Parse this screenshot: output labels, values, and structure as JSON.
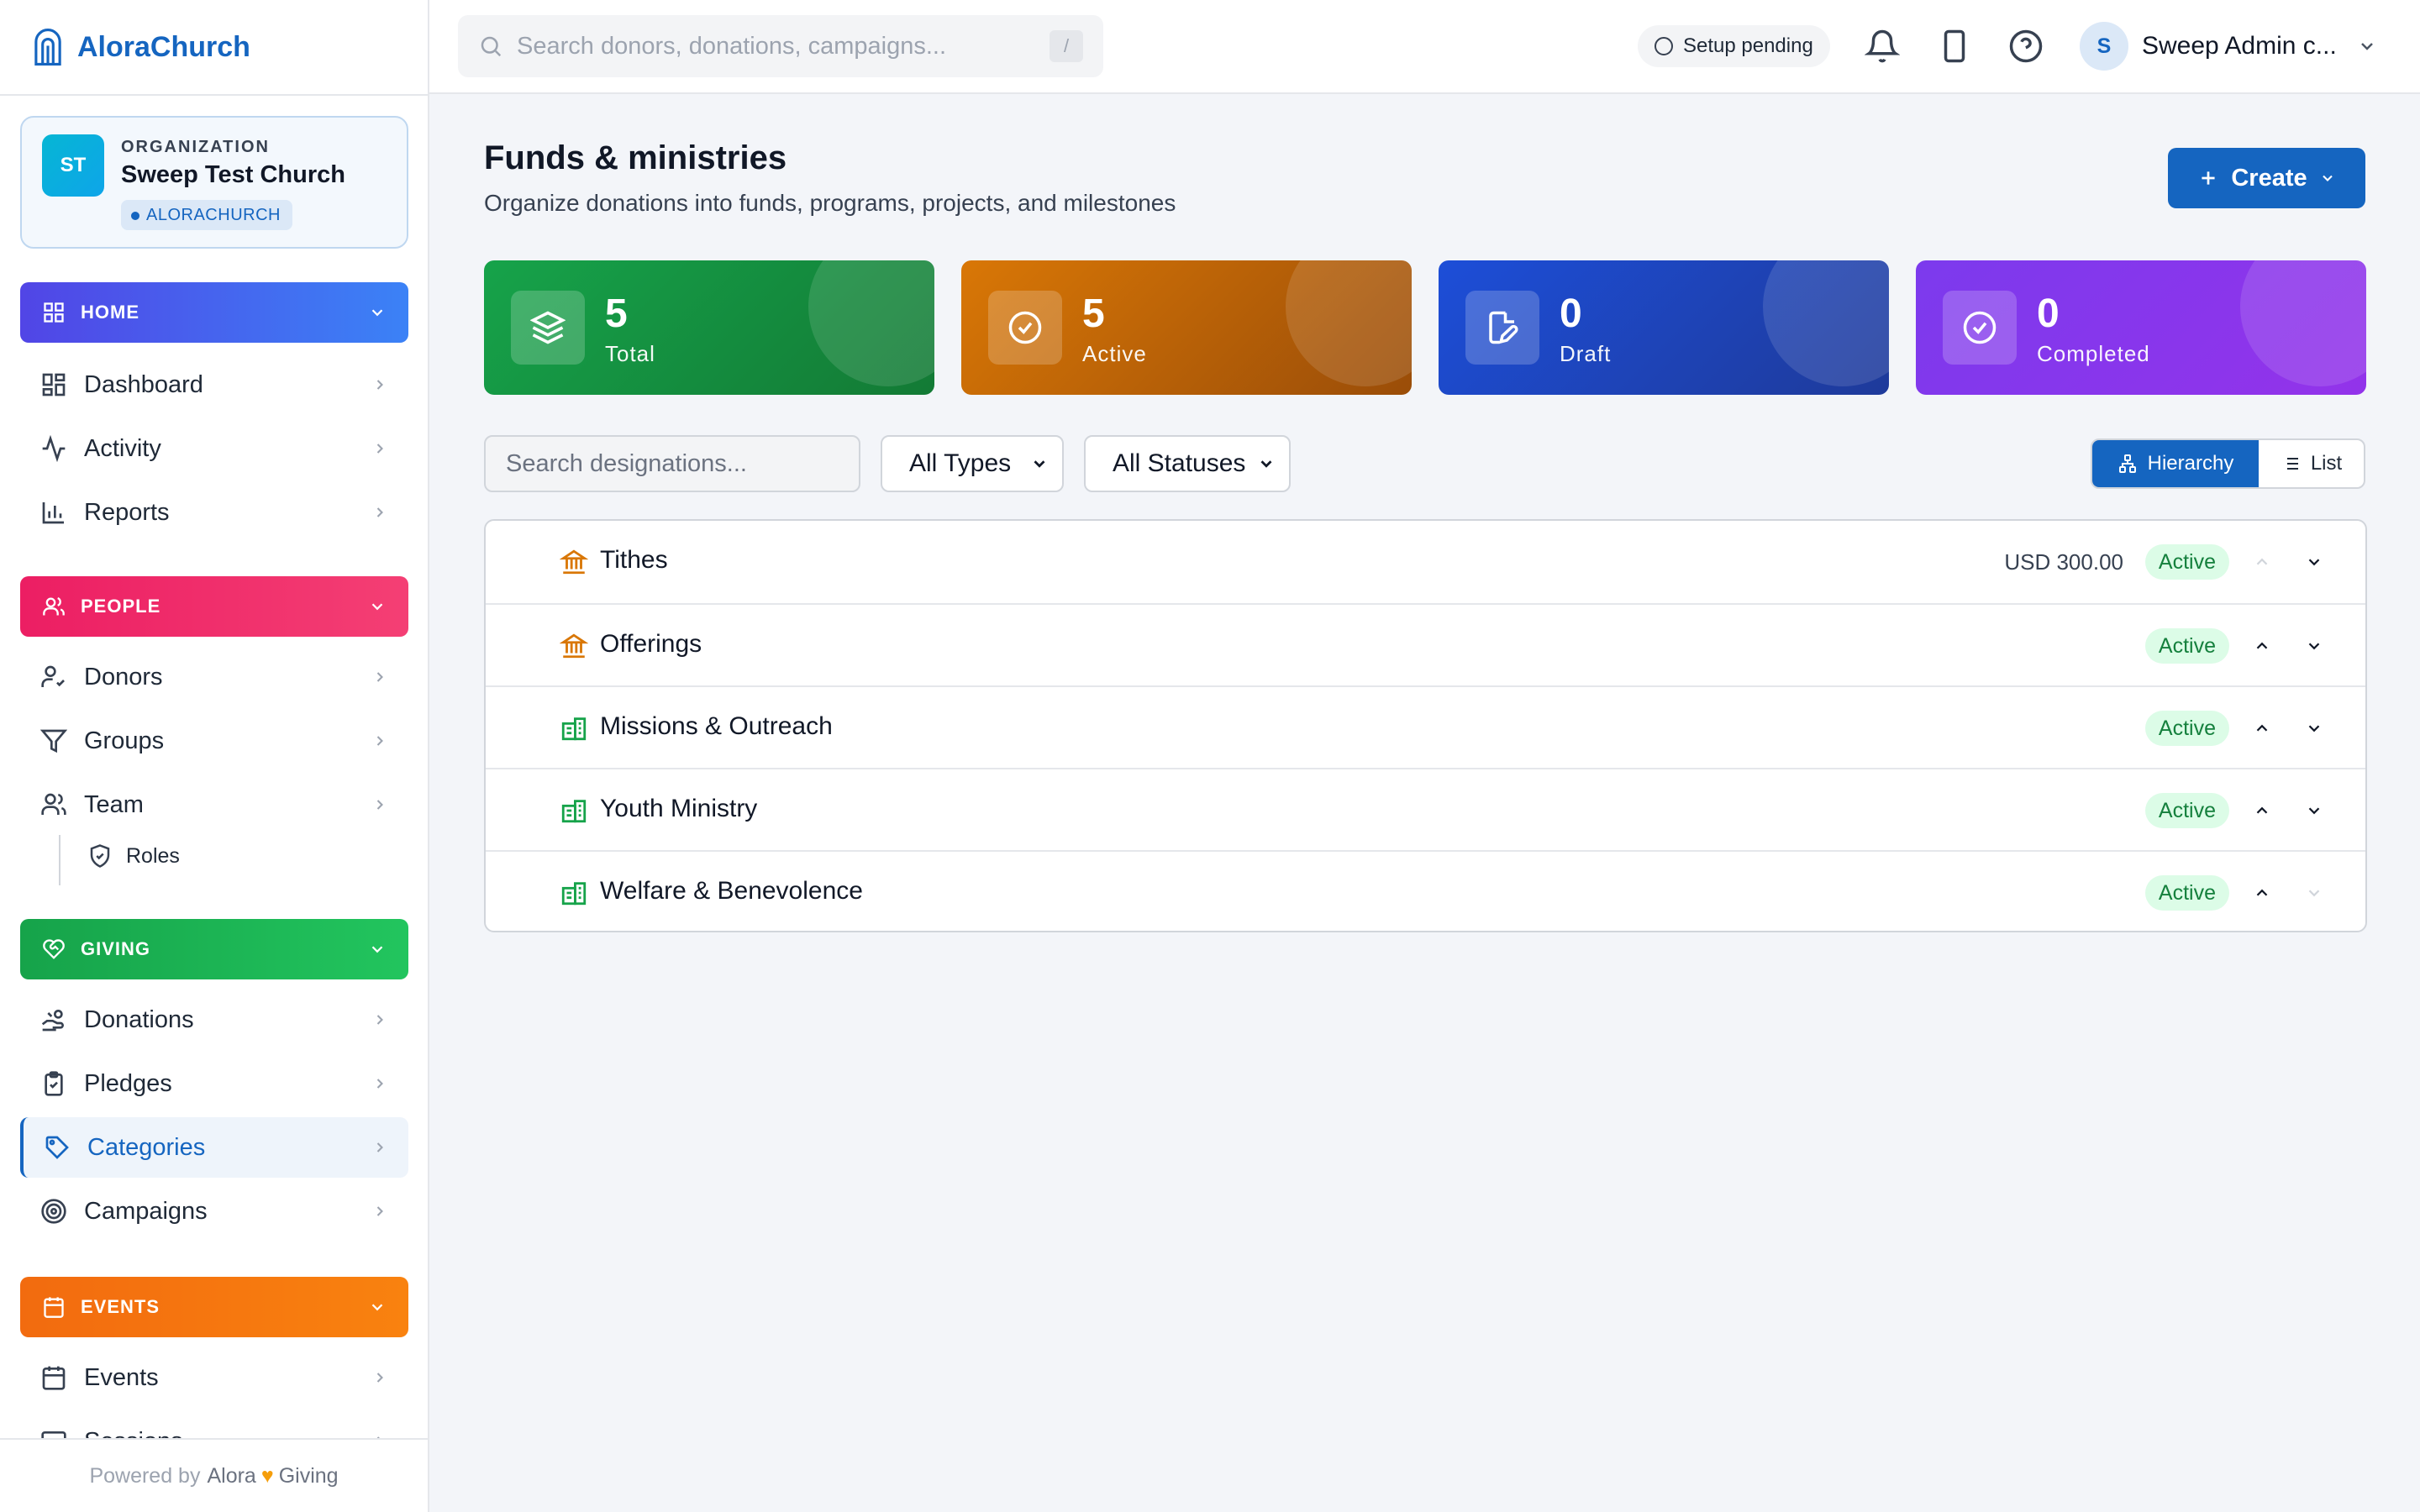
{
  "brand": {
    "name": "AloraChurch"
  },
  "organization": {
    "label": "ORGANIZATION",
    "initials": "ST",
    "name": "Sweep Test Church",
    "badge": "ALORACHURCH"
  },
  "sidebar": {
    "sections": [
      {
        "title": "HOME",
        "items": [
          {
            "label": "Dashboard",
            "icon": "dashboard-icon"
          },
          {
            "label": "Activity",
            "icon": "activity-icon"
          },
          {
            "label": "Reports",
            "icon": "reports-icon"
          }
        ]
      },
      {
        "title": "PEOPLE",
        "items": [
          {
            "label": "Donors",
            "icon": "donors-icon"
          },
          {
            "label": "Groups",
            "icon": "funnel-icon"
          },
          {
            "label": "Team",
            "icon": "team-icon"
          }
        ],
        "sub_items": [
          {
            "label": "Roles",
            "icon": "shield-icon"
          }
        ]
      },
      {
        "title": "GIVING",
        "items": [
          {
            "label": "Donations",
            "icon": "hand-coins-icon"
          },
          {
            "label": "Pledges",
            "icon": "clipboard-check-icon"
          },
          {
            "label": "Categories",
            "icon": "tag-icon",
            "active": true
          },
          {
            "label": "Campaigns",
            "icon": "target-icon"
          }
        ]
      },
      {
        "title": "EVENTS",
        "items": [
          {
            "label": "Events",
            "icon": "calendar-icon"
          },
          {
            "label": "Sessions",
            "icon": "sessions-icon"
          }
        ]
      }
    ],
    "footer": {
      "prefix": "Powered by",
      "brand_a": "Alora",
      "heart": "♥",
      "brand_b": "Giving"
    }
  },
  "topbar": {
    "search_placeholder": "Search donors, donations, campaigns...",
    "search_shortcut": "/",
    "setup_status": "Setup pending",
    "user": {
      "initial": "S",
      "name": "Sweep Admin c..."
    }
  },
  "page": {
    "title": "Funds & ministries",
    "subtitle": "Organize donations into funds, programs, projects, and milestones",
    "create_label": "Create"
  },
  "stats": [
    {
      "value": "5",
      "label": "Total",
      "icon": "layers-icon",
      "color": "#16a34a"
    },
    {
      "value": "5",
      "label": "Active",
      "icon": "check-circle-icon",
      "color": "#d97706"
    },
    {
      "value": "0",
      "label": "Draft",
      "icon": "file-edit-icon",
      "color": "#1d4ed8"
    },
    {
      "value": "0",
      "label": "Completed",
      "icon": "check-circle-icon",
      "color": "#7c3aed"
    }
  ],
  "filters": {
    "search_placeholder": "Search designations...",
    "type_selected": "All Types",
    "status_selected": "All Statuses"
  },
  "view_toggle": {
    "hierarchy": "Hierarchy",
    "list": "List",
    "selected": "Hierarchy"
  },
  "designations": [
    {
      "name": "Tithes",
      "icon": "bank-icon",
      "amount": "USD 300.00",
      "status": "Active",
      "up_enabled": false,
      "down_enabled": true
    },
    {
      "name": "Offerings",
      "icon": "bank-icon",
      "amount": "",
      "status": "Active",
      "up_enabled": true,
      "down_enabled": true
    },
    {
      "name": "Missions & Outreach",
      "icon": "building-icon",
      "amount": "",
      "status": "Active",
      "up_enabled": true,
      "down_enabled": true
    },
    {
      "name": "Youth Ministry",
      "icon": "building-icon",
      "amount": "",
      "status": "Active",
      "up_enabled": true,
      "down_enabled": true
    },
    {
      "name": "Welfare & Benevolence",
      "icon": "building-icon",
      "amount": "",
      "status": "Active",
      "up_enabled": true,
      "down_enabled": false
    }
  ],
  "colors": {
    "primary": "#1565c0",
    "active_badge_bg": "#dcfce7",
    "active_badge_text": "#15803d",
    "fund_icon": "#d97706",
    "program_icon": "#16a34a"
  }
}
